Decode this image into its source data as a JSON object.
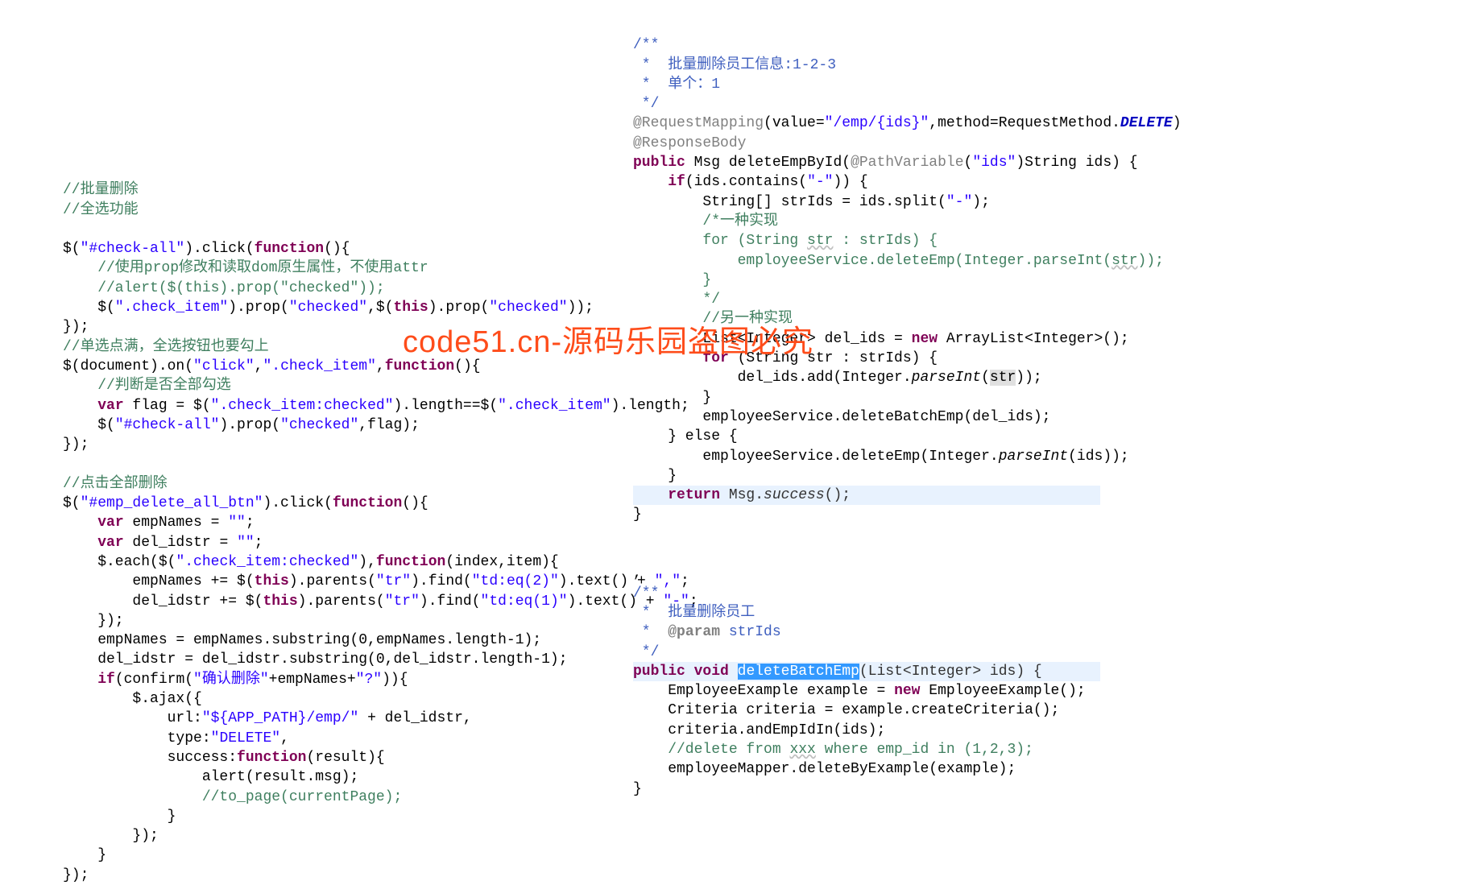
{
  "watermark": "code51.cn-源码乐园盗图必究",
  "left": {
    "l01": "//批量删除",
    "l02": "//全选功能",
    "l04a": "$(",
    "l04b": "\"#check-all\"",
    "l04c": ").click(",
    "l04d": "function",
    "l04e": "(){",
    "l05": "    //使用prop修改和读取dom原生属性，不使用attr",
    "l06": "    //alert($(this).prop(\"checked\"));",
    "l07a": "    $(",
    "l07b": "\".check_item\"",
    "l07c": ").prop(",
    "l07d": "\"checked\"",
    "l07e": ",$(",
    "l07f": "this",
    "l07g": ").prop(",
    "l07h": "\"checked\"",
    "l07i": "));",
    "l08": "});",
    "l09": "//单选点满，全选按钮也要勾上",
    "l10a": "$(document).on(",
    "l10b": "\"click\"",
    "l10c": ",",
    "l10d": "\".check_item\"",
    "l10e": ",",
    "l10f": "function",
    "l10g": "(){",
    "l11": "    //判断是否全部勾选",
    "l12a": "    ",
    "l12b": "var",
    "l12c": " flag = $(",
    "l12d": "\".check_item:checked\"",
    "l12e": ").length==$(",
    "l12f": "\".check_item\"",
    "l12g": ").length;",
    "l13a": "    $(",
    "l13b": "\"#check-all\"",
    "l13c": ").prop(",
    "l13d": "\"checked\"",
    "l13e": ",flag);",
    "l14": "});",
    "l16": "//点击全部删除",
    "l17a": "$(",
    "l17b": "\"#emp_delete_all_btn\"",
    "l17c": ").click(",
    "l17d": "function",
    "l17e": "(){",
    "l18a": "    ",
    "l18b": "var",
    "l18c": " empNames = ",
    "l18d": "\"\"",
    "l18e": ";",
    "l19a": "    ",
    "l19b": "var",
    "l19c": " del_idstr = ",
    "l19d": "\"\"",
    "l19e": ";",
    "l20a": "    $.each($(",
    "l20b": "\".check_item:checked\"",
    "l20c": "),",
    "l20d": "function",
    "l20e": "(index,item){",
    "l21a": "        empNames += $(",
    "l21b": "this",
    "l21c": ").parents(",
    "l21d": "\"tr\"",
    "l21e": ").find(",
    "l21f": "\"td:eq(2)\"",
    "l21g": ").text() + ",
    "l21h": "\",\"",
    "l21i": ";",
    "l22a": "        del_idstr += $(",
    "l22b": "this",
    "l22c": ").parents(",
    "l22d": "\"tr\"",
    "l22e": ").find(",
    "l22f": "\"td:eq(1)\"",
    "l22g": ").text() + ",
    "l22h": "\"-\"",
    "l22i": ";",
    "l23": "    });",
    "l24": "    empNames = empNames.substring(0,empNames.length-1);",
    "l25": "    del_idstr = del_idstr.substring(0,del_idstr.length-1);",
    "l26a": "    ",
    "l26b": "if",
    "l26c": "(confirm(",
    "l26d": "\"确认删除\"",
    "l26e": "+empNames+",
    "l26f": "\"?\"",
    "l26g": ")){",
    "l27": "        $.ajax({",
    "l28a": "            url:",
    "l28b": "\"${APP_PATH}/emp/\"",
    "l28c": " + del_idstr,",
    "l29a": "            type:",
    "l29b": "\"DELETE\"",
    "l29c": ",",
    "l30a": "            success:",
    "l30b": "function",
    "l30c": "(result){",
    "l31": "                alert(result.msg);",
    "l32": "                //to_page(currentPage);",
    "l33": "            }",
    "l34": "        });",
    "l35": "    }",
    "l36": "});"
  },
  "right": {
    "r01": "/**",
    "r02": " *  批量删除员工信息:1-2-3",
    "r03": " *  单个：1",
    "r04": " */",
    "r05a": "@RequestMapping",
    "r05b": "(value=",
    "r05c": "\"/emp/{ids}\"",
    "r05d": ",method=RequestMethod.",
    "r05e": "DELETE",
    "r05f": ")",
    "r06": "@ResponseBody",
    "r07a": "public",
    "r07b": " Msg ",
    "r07c": "deleteEmpById",
    "r07d": "(",
    "r07e": "@PathVariable",
    "r07f": "(",
    "r07g": "\"ids\"",
    "r07h": ")String ids) {",
    "r08a": "    ",
    "r08b": "if",
    "r08c": "(ids.contains(",
    "r08d": "\"-\"",
    "r08e": ")) {",
    "r09a": "        String[] strIds = ids.split(",
    "r09b": "\"-\"",
    "r09c": ");",
    "r10": "        /*一种实现",
    "r11a": "        for (String ",
    "r11b": "str",
    "r11c": " : strIds) {",
    "r12a": "            employeeService.deleteEmp(Integer.parseInt(",
    "r12b": "str",
    "r12c": "));",
    "r13": "        }",
    "r14": "        */",
    "r15": "        //另一种实现",
    "r16a": "        List<Integer> del_ids = ",
    "r16b": "new",
    "r16c": " ArrayList<Integer>();",
    "r17a": "        ",
    "r17b": "for",
    "r17c": " (String str : strIds) {",
    "r18a": "            del_ids.add(Integer.",
    "r18b": "parseInt",
    "r18c": "(",
    "r18d": "str",
    "r18e": "));",
    "r19": "        }",
    "r20": "        employeeService.deleteBatchEmp(del_ids);",
    "r21": "    } else {",
    "r22a": "        employeeService.deleteEmp(Integer.",
    "r22b": "parseInt",
    "r22c": "(ids));",
    "r23": "    }",
    "r24a": "    ",
    "r24b": "return",
    "r24c": " Msg.",
    "r24d": "success",
    "r24e": "();",
    "r25": "}",
    "r27": ",",
    "r28": "/**",
    "r29": " *  批量删除员工",
    "r30a": " *  ",
    "r30b": "@param",
    "r30c": " strIds",
    "r31": " */",
    "r32a": "public",
    "r32b": " ",
    "r32c": "void",
    "r32d": " ",
    "r32e": "deleteBatchEmp",
    "r32f": "(List<Integer> ids) {",
    "r33a": "    EmployeeExample example = ",
    "r33b": "new",
    "r33c": " EmployeeExample();",
    "r34": "    Criteria criteria = example.createCriteria();",
    "r35": "    criteria.andEmpIdIn(ids);",
    "r36a": "    //delete from ",
    "r36b": "xxx",
    "r36c": " where emp_id in (1,2,3);",
    "r37": "    employeeMapper.deleteByExample(example);",
    "r38": "}"
  }
}
